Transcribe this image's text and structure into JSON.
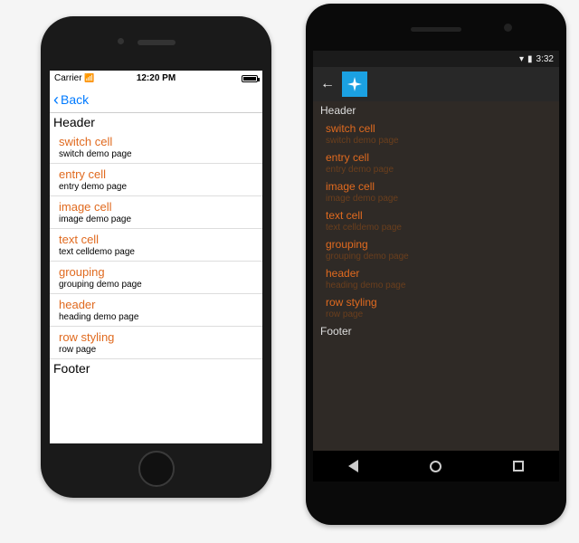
{
  "ios": {
    "status": {
      "carrier": "Carrier",
      "time": "12:20 PM"
    },
    "nav": {
      "back": "Back"
    },
    "header": "Header",
    "footer": "Footer",
    "rows": [
      {
        "title": "switch cell",
        "detail": "switch demo page"
      },
      {
        "title": "entry cell",
        "detail": "entry demo page"
      },
      {
        "title": "image cell",
        "detail": "image demo page"
      },
      {
        "title": "text cell",
        "detail": "text celldemo page"
      },
      {
        "title": "grouping",
        "detail": "grouping demo page"
      },
      {
        "title": "header",
        "detail": "heading demo page"
      },
      {
        "title": "row styling",
        "detail": "row page"
      }
    ]
  },
  "android": {
    "status": {
      "time": "3:32"
    },
    "header": "Header",
    "footer": "Footer",
    "rows": [
      {
        "title": "switch cell",
        "detail": "switch demo page"
      },
      {
        "title": "entry cell",
        "detail": "entry demo page"
      },
      {
        "title": "image cell",
        "detail": "image demo page"
      },
      {
        "title": "text cell",
        "detail": "text celldemo page"
      },
      {
        "title": "grouping",
        "detail": "grouping demo page"
      },
      {
        "title": "header",
        "detail": "heading demo page"
      },
      {
        "title": "row styling",
        "detail": "row page"
      }
    ]
  }
}
